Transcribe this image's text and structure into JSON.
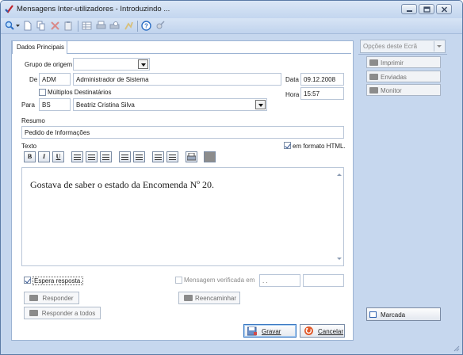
{
  "window": {
    "title": "Mensagens Inter-utilizadores - Introduzindo ...",
    "app_icon": "checkmark-app-icon",
    "controls": [
      "minimize-icon",
      "maximize-icon",
      "close-icon"
    ]
  },
  "toolbar": {
    "icons": [
      "search-icon",
      "new-document-icon",
      "copy-icon",
      "delete-icon",
      "paste-icon",
      "grid-icon",
      "print-icon",
      "print-preview-icon",
      "export-icon",
      "help-icon",
      "tools-icon"
    ]
  },
  "tab": {
    "label": "Dados Principais"
  },
  "form": {
    "grupo_label": "Grupo de origem",
    "grupo_value": "",
    "de_label": "De",
    "de_code": "ADM",
    "de_name": "Administrador de Sistema",
    "data_label": "Data",
    "data_value": "09.12.2008",
    "multiplos_label": "Múltiplos Destinatários",
    "multiplos_checked": false,
    "hora_label": "Hora",
    "hora_value": "15:57",
    "para_label": "Para",
    "para_code": "BS",
    "para_name": "Beatriz Cristina Silva",
    "resumo_label": "Resumo",
    "resumo_value": "Pedido de Informações",
    "texto_label": "Texto",
    "html_label": "em formato HTML.",
    "html_checked": true,
    "format_buttons": [
      "B",
      "I",
      "U"
    ],
    "body_text": "Gostava de saber o estado da Encomenda Nº 20.",
    "espera_label": "Espera resposta.",
    "espera_checked": true,
    "verificada_label": "Mensagem verificada em",
    "verificada_checked": false,
    "verificada_date": " .  .",
    "verificada_time": ""
  },
  "buttons": {
    "responder": "Responder",
    "reencaminhar": "Reencaminhar",
    "responder_todos": "Responder a todos",
    "gravar": "Gravar",
    "cancelar": "Cancelar"
  },
  "side": {
    "options_label": "Opções deste Ecrã",
    "imprimir": "Imprimir",
    "enviadas": "Enviadas",
    "monitor": "Monitor",
    "marcada": "Marcada"
  },
  "colors": {
    "window_bg": "#c6d7ee",
    "panel_bg": "#ffffff",
    "accent": "#3a78c2"
  }
}
